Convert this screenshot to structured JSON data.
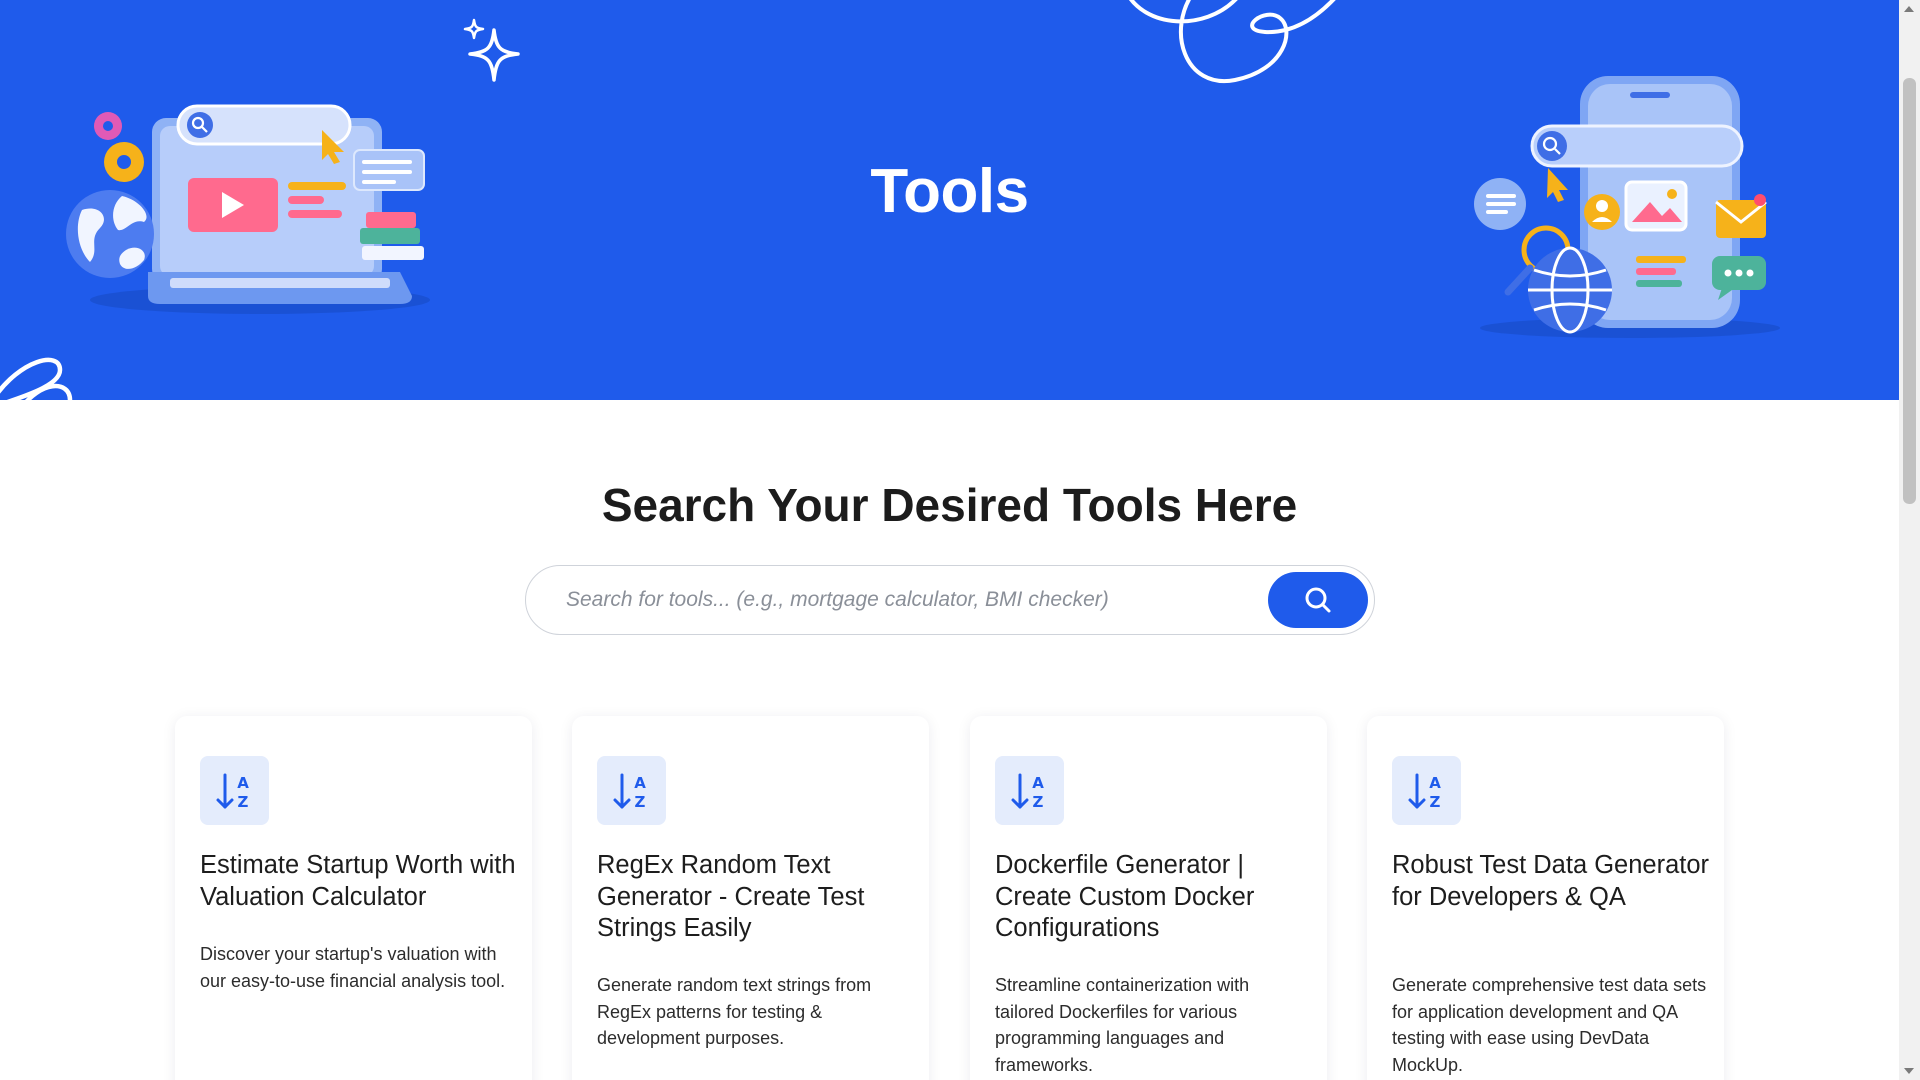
{
  "hero": {
    "title": "Tools",
    "background": "#1F5BEB"
  },
  "search": {
    "heading": "Search Your Desired Tools Here",
    "placeholder": "Search for tools... (e.g., mortgage calculator, BMI checker)",
    "button_icon": "search-icon"
  },
  "cards": [
    {
      "icon": "sort-az-icon",
      "title": "Estimate Startup Worth with Valuation Calculator",
      "description": "Discover your startup's valuation with our easy-to-use financial analysis tool."
    },
    {
      "icon": "sort-az-icon",
      "title": "RegEx Random Text Generator - Create Test Strings Easily",
      "description": "Generate random text strings from RegEx patterns for testing & development purposes."
    },
    {
      "icon": "sort-az-icon",
      "title": "Dockerfile Generator | Create Custom Docker Configurations",
      "description": "Streamline containerization with tailored Dockerfiles for various programming languages and frameworks."
    },
    {
      "icon": "sort-az-icon",
      "title": "Robust Test Data Generator for Developers & QA",
      "description": "Generate comprehensive test data sets for application development and QA testing with ease using DevData MockUp."
    }
  ],
  "colors": {
    "accent": "#1F5BEB",
    "icon_tile": "#E4ECFC"
  }
}
